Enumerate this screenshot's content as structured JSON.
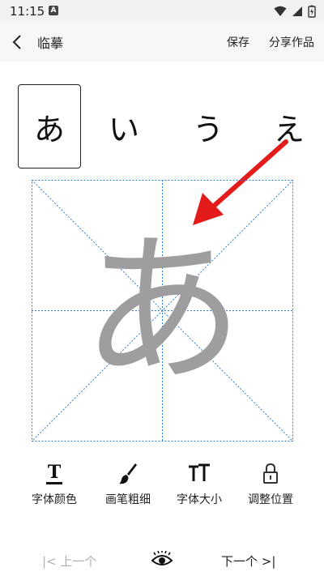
{
  "status_bar": {
    "time": "11:15",
    "notification": "A"
  },
  "header": {
    "title": "临摹",
    "save_label": "保存",
    "share_label": "分享作品"
  },
  "characters": [
    {
      "label": "あ",
      "selected": true
    },
    {
      "label": "い",
      "selected": false
    },
    {
      "label": "う",
      "selected": false
    },
    {
      "label": "え",
      "selected": false
    }
  ],
  "canvas": {
    "character": "あ",
    "grid_color": "#2b7bd1",
    "char_color": "#9e9e9e"
  },
  "toolbar": {
    "items": [
      {
        "label": "字体颜色",
        "icon": "text-color-icon"
      },
      {
        "label": "画笔粗细",
        "icon": "brush-icon"
      },
      {
        "label": "字体大小",
        "icon": "font-size-icon"
      },
      {
        "label": "调整位置",
        "icon": "lock-icon"
      }
    ]
  },
  "bottom_nav": {
    "prev_label": "上一个",
    "next_label": "下一个",
    "prev_glyph": "|<",
    "next_glyph": ">|"
  },
  "colors": {
    "accent_arrow": "#e31b1b",
    "disabled_text": "#b0b0b0"
  }
}
